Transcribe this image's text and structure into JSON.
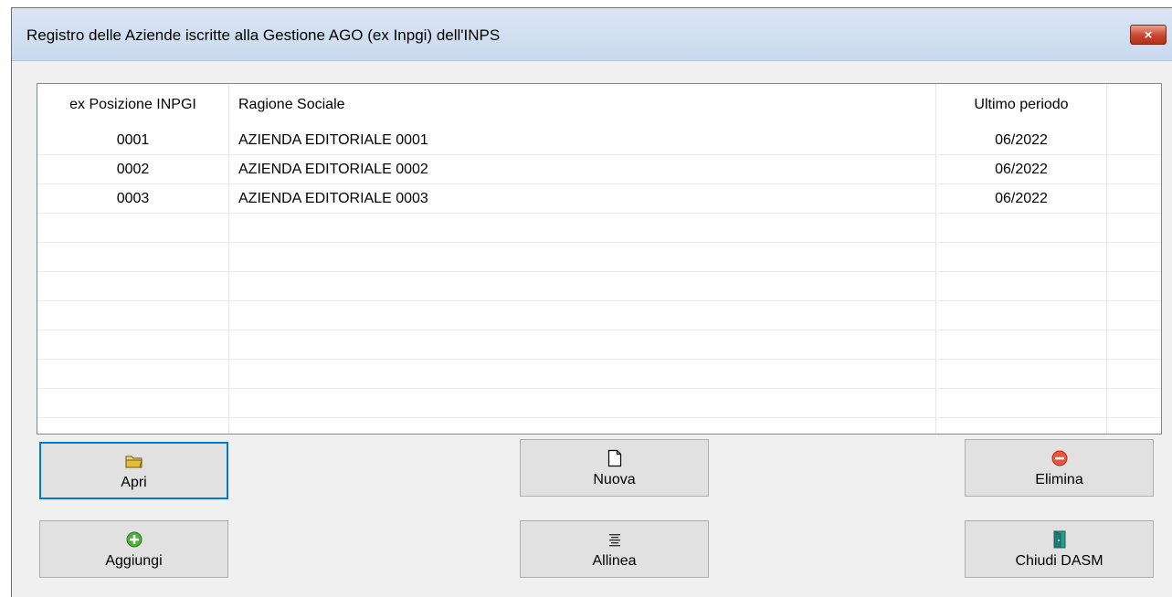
{
  "window": {
    "title": "Registro delle Aziende iscritte alla Gestione AGO (ex Inpgi) dell'INPS",
    "close_label": "×"
  },
  "grid": {
    "columns": [
      "ex Posizione INPGI",
      "Ragione Sociale",
      "Ultimo periodo"
    ],
    "rows": [
      [
        "0001",
        "AZIENDA EDITORIALE 0001",
        "06/2022"
      ],
      [
        "0002",
        "AZIENDA EDITORIALE 0002",
        "06/2022"
      ],
      [
        "0003",
        "AZIENDA EDITORIALE 0003",
        "06/2022"
      ]
    ]
  },
  "buttons": {
    "apri": "Apri",
    "nuova": "Nuova",
    "elimina": "Elimina",
    "aggiungi": "Aggiungi",
    "allinea": "Allinea",
    "chiudi": "Chiudi DASM"
  },
  "icons": {
    "apri": "folder-icon",
    "nuova": "document-icon",
    "elimina": "remove-icon",
    "aggiungi": "add-icon",
    "allinea": "align-icon",
    "chiudi": "exit-door-icon"
  },
  "colors": {
    "focus": "#0078d7",
    "title_bar": "#c9d9ee",
    "close": "#c8452e"
  }
}
